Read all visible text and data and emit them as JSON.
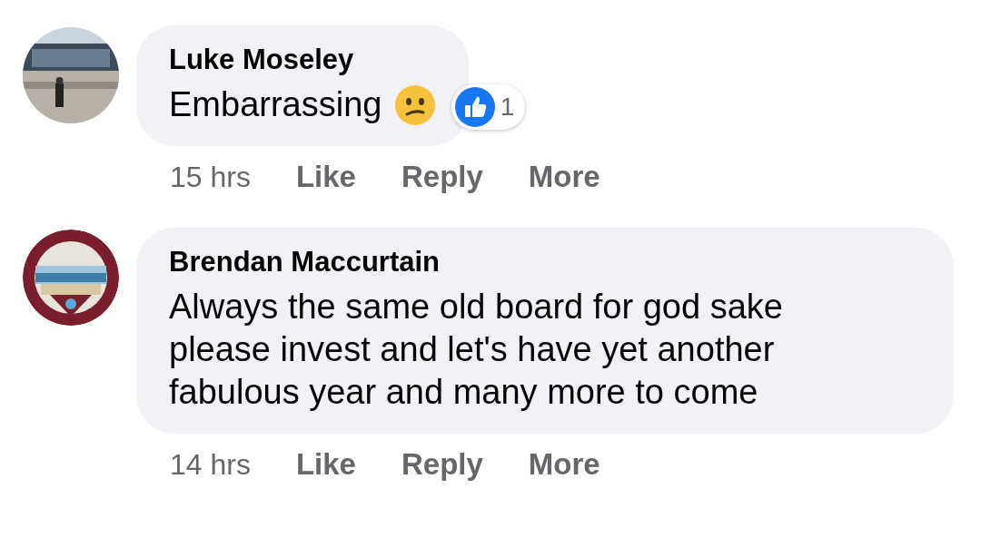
{
  "comments": [
    {
      "author": "Luke Moseley",
      "text": "Embarrassing",
      "emoji": true,
      "reaction": {
        "kind": "like",
        "count": "1"
      },
      "time": "15 hrs",
      "actions": [
        "Like",
        "Reply",
        "More"
      ]
    },
    {
      "author": "Brendan Maccurtain",
      "text": "Always the same old board for god sake please invest and let's have yet another fabulous year and many more to come",
      "time": "14 hrs",
      "actions": [
        "Like",
        "Reply",
        "More"
      ]
    }
  ]
}
